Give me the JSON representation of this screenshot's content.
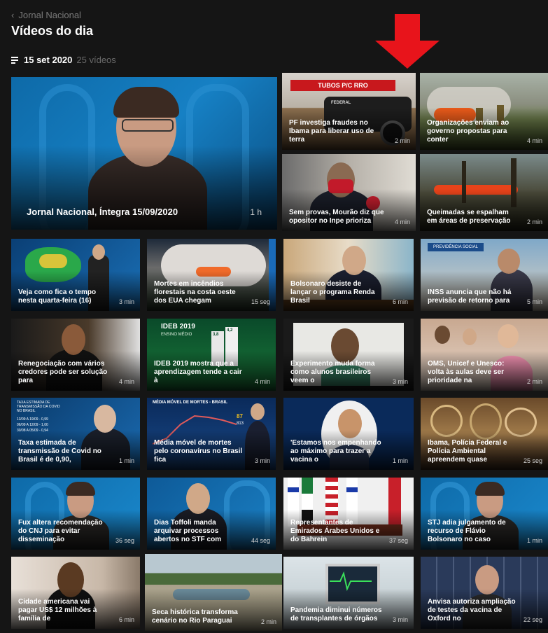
{
  "header": {
    "back_label": "Jornal Nacional",
    "title": "Vídeos do dia",
    "date": "15 set 2020",
    "count": "25 vídeos"
  },
  "featured": {
    "caption": "Jornal Nacional, Íntegra 15/09/2020",
    "duration": "1 h"
  },
  "videos": [
    {
      "caption": "PF investiga fraudes no Ibama para liberar uso de terra",
      "duration": "2 min"
    },
    {
      "caption": "Organizações enviam ao governo propostas para conter",
      "duration": "4 min"
    },
    {
      "caption": "Sem provas, Mourão diz que opositor no Inpe prioriza",
      "duration": "4 min"
    },
    {
      "caption": "Queimadas se espalham em áreas de preservação",
      "duration": "2 min"
    },
    {
      "caption": "Veja como fica o tempo nesta quarta-feira (16)",
      "duration": "3 min"
    },
    {
      "caption": "Mortes em incêndios florestais na costa oeste dos EUA chegam",
      "duration": "15 seg"
    },
    {
      "caption": "Bolsonaro desiste de lançar o programa Renda Brasil",
      "duration": "6 min"
    },
    {
      "caption": "INSS anuncia que não há previsão de retorno para",
      "duration": "5 min"
    },
    {
      "caption": "Renegociação com vários credores pode ser solução para",
      "duration": "4 min"
    },
    {
      "caption": "IDEB 2019 mostra que a aprendizagem tende a cair à",
      "duration": "4 min"
    },
    {
      "caption": "Experimento muda forma como alunos brasileiros veem o",
      "duration": "3 min"
    },
    {
      "caption": "OMS, Unicef e Unesco: volta às aulas deve ser prioridade na",
      "duration": "2 min"
    },
    {
      "caption": "Taxa estimada de transmissão de Covid no Brasil é de 0,90,",
      "duration": "1 min"
    },
    {
      "caption": "Média móvel de mortes pelo coronavírus no Brasil fica",
      "duration": "3 min"
    },
    {
      "caption": "'Estamos nos empenhando ao máximo para trazer a vacina o",
      "duration": "1 min"
    },
    {
      "caption": "Ibama, Polícia Federal e Polícia Ambiental apreendem quase",
      "duration": "25 seg"
    },
    {
      "caption": "Fux altera recomendação do CNJ para evitar disseminação",
      "duration": "36 seg"
    },
    {
      "caption": "Dias Toffoli manda arquivar processos abertos no STF com",
      "duration": "44 seg"
    },
    {
      "caption": "Representantes de Emirados Árabes Unidos e do Bahrein",
      "duration": "37 seg"
    },
    {
      "caption": "STJ adia julgamento de recurso de Flávio Bolsonaro no caso",
      "duration": "1 min"
    },
    {
      "caption": "Cidade americana vai pagar US$ 12 milhões à família de",
      "duration": "6 min"
    },
    {
      "caption": "Seca histórica transforma cenário no Rio Paraguai",
      "duration": "2 min"
    },
    {
      "caption": "Pandemia diminui números de transplantes de órgãos",
      "duration": "3 min"
    },
    {
      "caption": "Anvisa autoriza ampliação de testes da vacina de Oxford no",
      "duration": "22 seg"
    }
  ],
  "thumb_text": {
    "truck_sign": "TUBOS P/C   RRO",
    "federal": "FEDERAL",
    "ideb_title": "IDEB 2019",
    "ideb_sub": "ENSINO MÉDIO",
    "ideb_v1": "3,8",
    "ideb_v2": "4,2",
    "covid_title": "TAXA ESTIMADA DE TRANSMISSÃO DA COVID NO BRASIL",
    "covid_r1": "13/09 A 19/09 - 0,99",
    "covid_r2": "06/09 A 12/09 - 1,00",
    "covid_r3": "30/08 A 05/09 - 0,94",
    "media_title": "MÉDIA MÓVEL DE MORTES - BRASIL",
    "media_val1": "87",
    "media_val2": "813",
    "inss_sign": "PREVIDÊNCIA SOCIAL"
  },
  "colors": {
    "red_highlight": "#e8141b",
    "yellow_highlight": "#f7e600",
    "arrow": "#e8141b",
    "background": "#151515"
  }
}
